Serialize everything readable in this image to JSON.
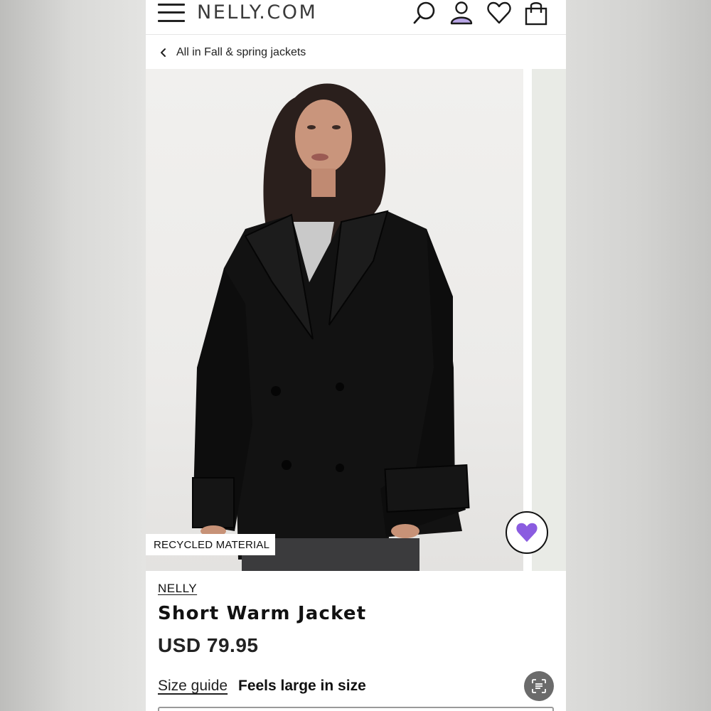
{
  "header": {
    "logo": "NELLY.COM",
    "icons": [
      "menu-icon",
      "search-icon",
      "account-icon",
      "heart-icon",
      "bag-icon"
    ],
    "account_color": "#b9a6e6"
  },
  "breadcrumb": {
    "label": "All in Fall & spring jackets"
  },
  "gallery": {
    "badge": "RECYCLED MATERIAL",
    "favorite_color": "#8a5ce0"
  },
  "product": {
    "brand": "NELLY",
    "name": "Short Warm Jacket",
    "price": "USD 79.95",
    "size_guide": "Size guide",
    "fit_note": "Feels large in size"
  }
}
